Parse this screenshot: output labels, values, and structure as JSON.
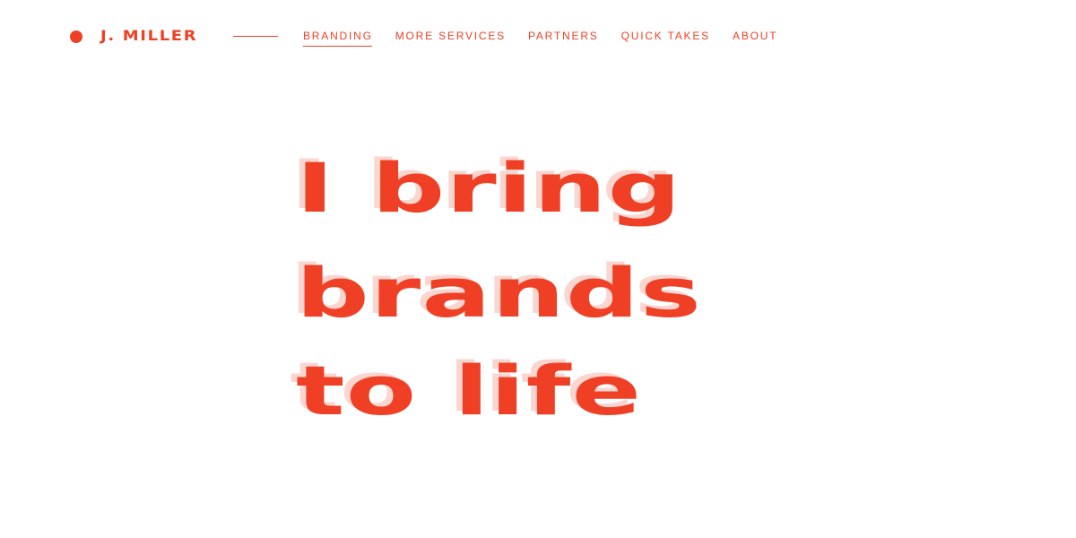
{
  "header": {
    "brand_name": "J. MILLER",
    "nav_items": [
      {
        "label": "BRANDING",
        "active": true
      },
      {
        "label": "MORE SERVICES",
        "active": false
      },
      {
        "label": "PARTNERS",
        "active": false
      },
      {
        "label": "QUICK TAKES",
        "active": false
      },
      {
        "label": "ABOUT",
        "active": false
      }
    ]
  },
  "hero": {
    "lines": [
      "I bring",
      "brands",
      "to life"
    ]
  },
  "colors": {
    "accent": "#ef4026",
    "background": "#ffffff",
    "ghost_text": "#f8c8c0"
  }
}
